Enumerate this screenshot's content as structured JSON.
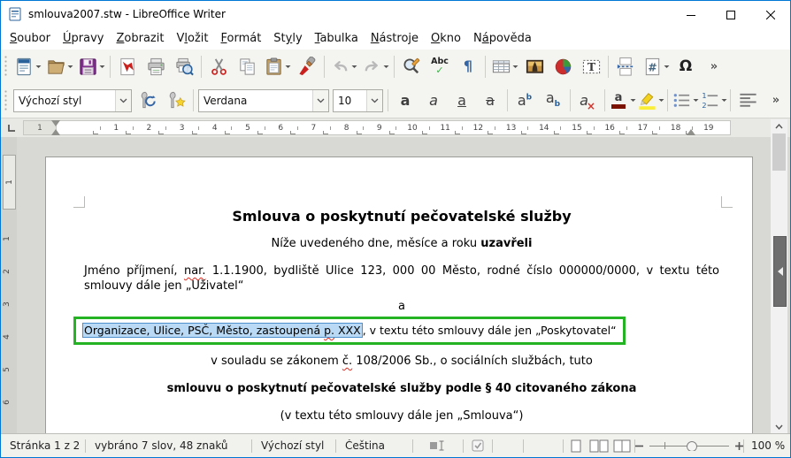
{
  "window": {
    "title": "smlouva2007.stw - LibreOffice Writer"
  },
  "menu": {
    "items": [
      {
        "name": "soubor",
        "label": "Soubor",
        "mnemonic": 0
      },
      {
        "name": "upravy",
        "label": "Úpravy",
        "mnemonic": 0
      },
      {
        "name": "zobrazit",
        "label": "Zobrazit",
        "mnemonic": 0
      },
      {
        "name": "vlozit",
        "label": "Vložit",
        "mnemonic": 1
      },
      {
        "name": "format",
        "label": "Formát",
        "mnemonic": 0
      },
      {
        "name": "styly",
        "label": "Styly",
        "mnemonic": 2
      },
      {
        "name": "tabulka",
        "label": "Tabulka",
        "mnemonic": 0
      },
      {
        "name": "nastroje",
        "label": "Nástroje",
        "mnemonic": 0
      },
      {
        "name": "okno",
        "label": "Okno",
        "mnemonic": 0
      },
      {
        "name": "napoveda",
        "label": "Nápověda",
        "mnemonic": 1
      }
    ]
  },
  "toolbar_standard": {
    "items": [
      {
        "type": "grip"
      },
      {
        "type": "button",
        "name": "new-button",
        "icon": "new",
        "dropdown": true
      },
      {
        "type": "button",
        "name": "open-button",
        "icon": "open",
        "dropdown": true
      },
      {
        "type": "button",
        "name": "save-button",
        "icon": "save",
        "dropdown": true
      },
      {
        "type": "sep"
      },
      {
        "type": "button",
        "name": "export-pdf-button",
        "icon": "pdf"
      },
      {
        "type": "button",
        "name": "print-button",
        "icon": "print"
      },
      {
        "type": "button",
        "name": "print-preview-button",
        "icon": "preview"
      },
      {
        "type": "sep"
      },
      {
        "type": "button",
        "name": "cut-button",
        "icon": "cut"
      },
      {
        "type": "button",
        "name": "copy-button",
        "icon": "copy"
      },
      {
        "type": "button",
        "name": "paste-button",
        "icon": "paste",
        "dropdown": true
      },
      {
        "type": "button",
        "name": "clone-formatting-button",
        "icon": "clone"
      },
      {
        "type": "sep"
      },
      {
        "type": "button",
        "name": "undo-button",
        "icon": "undo",
        "dropdown": true,
        "disabled": true
      },
      {
        "type": "button",
        "name": "redo-button",
        "icon": "redo",
        "dropdown": true,
        "disabled": true
      },
      {
        "type": "sep"
      },
      {
        "type": "button",
        "name": "find-replace-button",
        "icon": "find"
      },
      {
        "type": "button",
        "name": "spelling-button",
        "icon": "spelling"
      },
      {
        "type": "button",
        "name": "formatting-marks-button",
        "icon": "pilcrow"
      },
      {
        "type": "sep"
      },
      {
        "type": "button",
        "name": "insert-table-button",
        "icon": "table",
        "dropdown": true
      },
      {
        "type": "button",
        "name": "insert-image-button",
        "icon": "image"
      },
      {
        "type": "button",
        "name": "insert-chart-button",
        "icon": "chart"
      },
      {
        "type": "button",
        "name": "insert-textbox-button",
        "icon": "textbox"
      },
      {
        "type": "sep"
      },
      {
        "type": "button",
        "name": "insert-page-break-button",
        "icon": "pagebreak"
      },
      {
        "type": "button",
        "name": "insert-field-button",
        "icon": "field",
        "dropdown": true
      },
      {
        "type": "button",
        "name": "special-character-button",
        "icon": "omega"
      },
      {
        "type": "button",
        "name": "toolbar-overflow-button",
        "icon": "overflow"
      }
    ]
  },
  "toolbar_formatting": {
    "style_combo": "Výchozí styl",
    "font_combo": "Verdana",
    "size_combo": "10",
    "items_a": [
      {
        "type": "button",
        "name": "update-style-button",
        "icon": "updatestyle"
      },
      {
        "type": "button",
        "name": "new-style-button",
        "icon": "newstyle"
      }
    ],
    "items_b": [
      {
        "type": "button",
        "name": "bold-button",
        "icon": "bold"
      },
      {
        "type": "button",
        "name": "italic-button",
        "icon": "italic"
      },
      {
        "type": "button",
        "name": "underline-button",
        "icon": "underline"
      },
      {
        "type": "button",
        "name": "strikethrough-button",
        "icon": "strike"
      },
      {
        "type": "sep"
      },
      {
        "type": "button",
        "name": "superscript-button",
        "icon": "super"
      },
      {
        "type": "button",
        "name": "subscript-button",
        "icon": "subscr"
      },
      {
        "type": "sep"
      },
      {
        "type": "button",
        "name": "clear-formatting-button",
        "icon": "clearfmt"
      },
      {
        "type": "sep"
      },
      {
        "type": "button",
        "name": "font-color-button",
        "icon": "fontcolor",
        "dropdown": true
      },
      {
        "type": "button",
        "name": "highlight-color-button",
        "icon": "highlight",
        "dropdown": true
      },
      {
        "type": "sep"
      },
      {
        "type": "button",
        "name": "bullet-list-button",
        "icon": "bullets",
        "dropdown": true
      },
      {
        "type": "button",
        "name": "numbered-list-button",
        "icon": "numbering",
        "dropdown": true
      },
      {
        "type": "sep"
      },
      {
        "type": "button",
        "name": "align-left-button",
        "icon": "alignleft"
      },
      {
        "type": "button",
        "name": "toolbar-overflow-button",
        "icon": "overflow"
      }
    ]
  },
  "icon_glyphs": {
    "pilcrow": "¶",
    "omega": "Ω",
    "overflow": "»",
    "spelling_text": "Abc",
    "spelling_check": "✓",
    "letter": "a",
    "super_letter": "b",
    "clear_x": "×",
    "textbox_letter": "T",
    "field_hash": "#",
    "num1": "1",
    "num2": "2"
  },
  "ruler": {
    "h_margin_label": "1",
    "h_numbers": [
      "1",
      "2",
      "3",
      "4",
      "5",
      "6",
      "7",
      "8",
      "9",
      "10",
      "11",
      "12",
      "13",
      "14",
      "15",
      "16",
      "17",
      "18",
      "19"
    ],
    "v_margin_label": "1",
    "v_numbers": [
      "1",
      "2",
      "3",
      "4",
      "5",
      "6"
    ]
  },
  "document": {
    "paragraphs": [
      {
        "cls": "p-title",
        "segments": [
          {
            "text": "Smlouva o poskytnutí pečovatelské služby",
            "bold": true
          }
        ]
      },
      {
        "cls": "p-uzavreli",
        "segments": [
          {
            "text": "Níže uvedeného dne, měsíce a roku "
          },
          {
            "text": "uzavřeli",
            "bold": true
          }
        ]
      },
      {
        "cls": "p-jmeno",
        "segments": [
          {
            "text": "Jméno příjmení, "
          },
          {
            "text": "nar.",
            "spell": true
          },
          {
            "text": " 1.1.1900, bydliště Ulice 123, 000 00 Město, rodné číslo 000000/0000, v textu této smlouvy dále jen „Uživatel“"
          }
        ]
      },
      {
        "cls": "p-a",
        "segments": [
          {
            "text": "a"
          }
        ]
      },
      {
        "cls": "p-box",
        "annotated": true,
        "segments": [
          {
            "text": "Organizace, Ulice, PSČ, Město, zastoupená ",
            "selected": true
          },
          {
            "text": "p.",
            "selected": true,
            "spell": true
          },
          {
            "text": " XXX",
            "selected": true
          },
          {
            "text": ", v textu této smlouvy dále jen „Poskytovatel“"
          }
        ]
      },
      {
        "cls": "p-souladu",
        "segments": [
          {
            "text": "v souladu se zákonem "
          },
          {
            "text": "č.",
            "spell": true
          },
          {
            "text": " 108/2006 Sb., o sociálních službách, tuto"
          }
        ]
      },
      {
        "cls": "p-smlouvu",
        "segments": [
          {
            "text": "smlouvu o poskytnutí pečovatelské služby podle § 40 citovaného zákona",
            "bold": true
          }
        ]
      },
      {
        "cls": "p-vtextu",
        "segments": [
          {
            "text": "(v textu této smlouvy dále jen „Smlouva“)"
          }
        ]
      }
    ]
  },
  "status_bar": {
    "page_info": "Stránka 1 z 2",
    "selection_info": "vybráno 7 slov, 48 znaků",
    "paragraph_style": "Výchozí styl",
    "language": "Čeština",
    "zoom_level": "100 %"
  },
  "colors": {
    "window_accent": "#0077d4",
    "annotation_green": "#23b323",
    "selection_fill": "#b9d9f4",
    "selection_border": "#4e8fcd",
    "spell_red": "#e02b20",
    "font_color_swatch": "#7b1200",
    "highlight_swatch": "#fbee36"
  }
}
